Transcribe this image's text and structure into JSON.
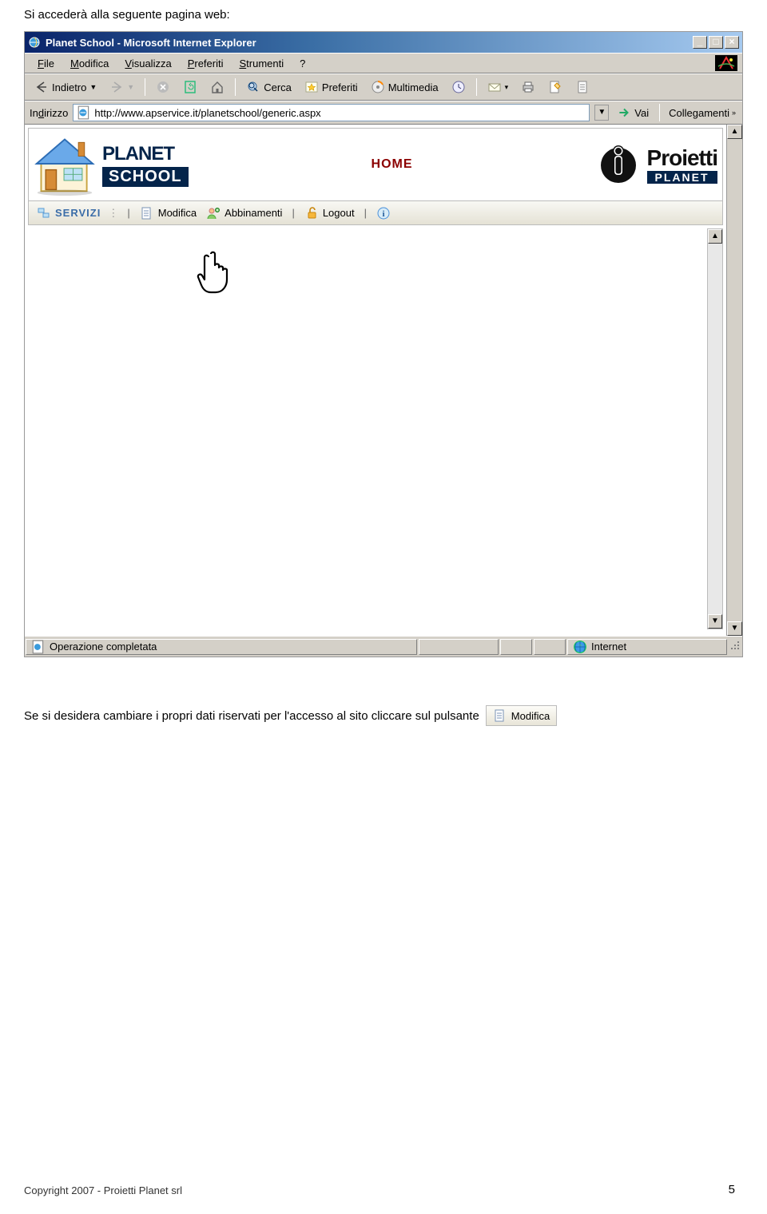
{
  "intro": "Si accederà alla seguente pagina web:",
  "window": {
    "title": "Planet School - Microsoft Internet Explorer",
    "minimize": "_",
    "maximize": "□",
    "close": "×"
  },
  "menus": {
    "file": "File",
    "modifica": "Modifica",
    "visualizza": "Visualizza",
    "preferiti": "Preferiti",
    "strumenti": "Strumenti",
    "help": "?"
  },
  "toolbar": {
    "back": "Indietro",
    "search": "Cerca",
    "favorites": "Preferiti",
    "media": "Multimedia"
  },
  "address": {
    "label": "Indirizzo",
    "url": "http://www.apservice.it/planetschool/generic.aspx",
    "go": "Vai",
    "links": "Collegamenti"
  },
  "page": {
    "planet": "PLANET",
    "school": "SCHOOL",
    "home": "HOME",
    "proietti": "Proietti",
    "proietti_sub": "PLANET",
    "nav": {
      "servizi": "SERVIZI",
      "modifica": "Modifica",
      "abbinamenti": "Abbinamenti",
      "logout": "Logout"
    }
  },
  "status": {
    "left": "Operazione completata",
    "zone": "Internet"
  },
  "footer": "Se si desidera cambiare i propri dati riservati per l'accesso al sito cliccare sul pulsante",
  "chip": {
    "label": "Modifica"
  },
  "copyright": "Copyright 2007 - Proietti Planet srl",
  "pagenum": "5"
}
